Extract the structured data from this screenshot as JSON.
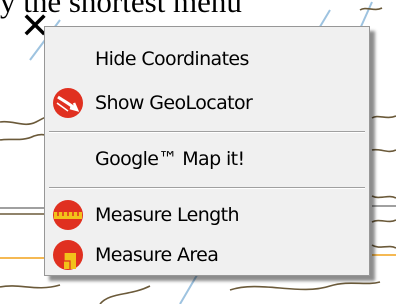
{
  "caption": "y the shortest menu",
  "menu": {
    "items": [
      {
        "label": "Hide Coordinates",
        "icon": ""
      },
      {
        "label": "Show GeoLocator",
        "icon": "geolocator-icon"
      },
      {
        "label": "Google™ Map it!",
        "icon": ""
      },
      {
        "label": "Measure Length",
        "icon": "measure-length-icon"
      },
      {
        "label": "Measure Area",
        "icon": "measure-area-icon"
      }
    ]
  },
  "colors": {
    "icon_red": "#e03020",
    "icon_yellow": "#f2c21a",
    "map_line": "#6b5a3a",
    "map_water": "#9ec3e0"
  }
}
